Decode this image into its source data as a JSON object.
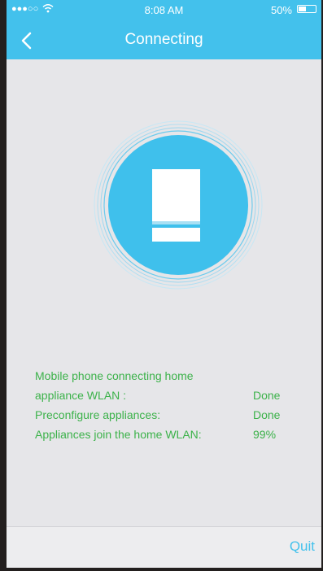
{
  "status_bar": {
    "signal": "●●●○○",
    "time": "8:08 AM",
    "battery": "50%",
    "battery_level": 0.5,
    "wifi_icon": "wifi-icon",
    "battery_icon": "battery-icon"
  },
  "header": {
    "title": "Connecting",
    "back_icon": "chevron-left-icon"
  },
  "colors": {
    "accent": "#43c1ec",
    "status_text": "#3cb24a",
    "background": "#e6e6e9"
  },
  "progress": {
    "rows": [
      {
        "label": "Mobile phone connecting home",
        "value": ""
      },
      {
        "label": "appliance WLAN :",
        "value": "Done"
      },
      {
        "label": "Preconfigure appliances:",
        "value": "Done"
      },
      {
        "label": "Appliances join the home WLAN:",
        "value": "99%"
      }
    ]
  },
  "footer": {
    "quit_label": "Quit"
  }
}
